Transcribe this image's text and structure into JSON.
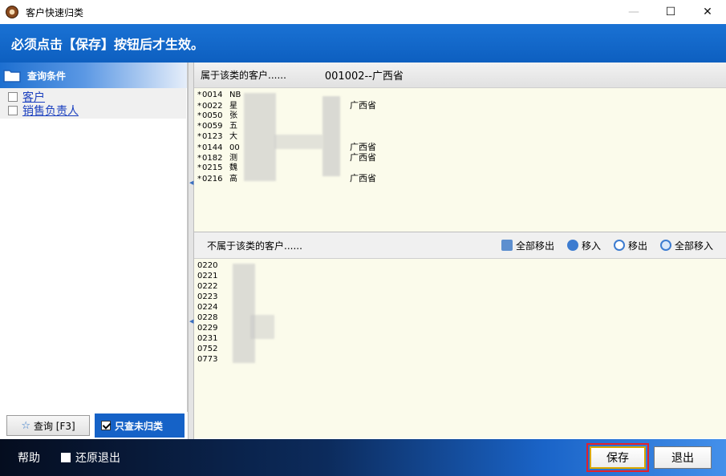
{
  "window": {
    "title": "客户快速归类",
    "min_glyph": "—",
    "max_glyph": "☐",
    "close_glyph": "✕"
  },
  "banner": {
    "text": "必须点击【保存】按钮后才生效。"
  },
  "left": {
    "header": "查询条件",
    "items": [
      {
        "label": "客户"
      },
      {
        "label": "销售负责人"
      }
    ],
    "query_button": "查询 [F3]",
    "only_unclassified": "只查未归类"
  },
  "belong": {
    "header": "属于该类的客户......",
    "category": "001002--广西省",
    "rows": [
      {
        "star": "*",
        "code": "0014",
        "name": "NB",
        "province": ""
      },
      {
        "star": "*",
        "code": "0022",
        "name": "星",
        "province": "广西省"
      },
      {
        "star": "*",
        "code": "0050",
        "name": "张",
        "province": ""
      },
      {
        "star": "*",
        "code": "0059",
        "name": "五",
        "province": ""
      },
      {
        "star": "*",
        "code": "0123",
        "name": "大",
        "province": ""
      },
      {
        "star": "*",
        "code": "0144",
        "name": "00",
        "province": "广西省"
      },
      {
        "star": "*",
        "code": "0182",
        "name": "测",
        "province": "广西省"
      },
      {
        "star": "*",
        "code": "0215",
        "name": "魏",
        "province": ""
      },
      {
        "star": "*",
        "code": "0216",
        "name": "高",
        "province": "广西省"
      }
    ]
  },
  "notbelong": {
    "header": "不属于该类的客户......",
    "tools": [
      {
        "label": "全部移出",
        "icon": "remove-all-icon"
      },
      {
        "label": "移入",
        "icon": "move-in-icon"
      },
      {
        "label": "移出",
        "icon": "move-out-icon"
      },
      {
        "label": "全部移入",
        "icon": "add-all-icon"
      }
    ],
    "rows": [
      {
        "code": "0220"
      },
      {
        "code": "0221"
      },
      {
        "code": "0222"
      },
      {
        "code": "0223"
      },
      {
        "code": "0224"
      },
      {
        "code": "0228"
      },
      {
        "code": "0229"
      },
      {
        "code": "0231"
      },
      {
        "code": "0752"
      },
      {
        "code": "0773"
      }
    ]
  },
  "footer": {
    "help": "帮助",
    "restore_exit": "还原退出",
    "save": "保存",
    "exit": "退出"
  },
  "colors": {
    "accent": "#1562c7",
    "highlight": "#e3212c",
    "list_bg": "#fbfbeb"
  }
}
